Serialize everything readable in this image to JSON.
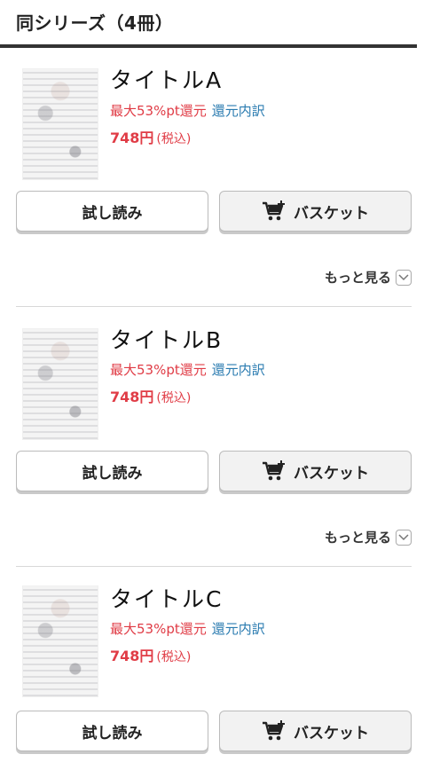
{
  "header": {
    "title": "同シリーズ（4冊）"
  },
  "items": [
    {
      "title": "タイトルA",
      "points": "最大53%pt還元",
      "points_breakdown": "還元内訳",
      "price": "748円",
      "tax": "(税込)",
      "try_read": "試し読み",
      "basket": "バスケット",
      "more": "もっと見る"
    },
    {
      "title": "タイトルB",
      "points": "最大53%pt還元",
      "points_breakdown": "還元内訳",
      "price": "748円",
      "tax": "(税込)",
      "try_read": "試し読み",
      "basket": "バスケット",
      "more": "もっと見る"
    },
    {
      "title": "タイトルC",
      "points": "最大53%pt還元",
      "points_breakdown": "還元内訳",
      "price": "748円",
      "tax": "(税込)",
      "try_read": "試し読み",
      "basket": "バスケット"
    }
  ],
  "icons": {
    "cart": "cart-plus-icon",
    "chevron": "chevron-down-icon"
  },
  "colors": {
    "accent_red": "#e03c46",
    "link_blue": "#2a7bb0",
    "header_rule": "#333333"
  }
}
